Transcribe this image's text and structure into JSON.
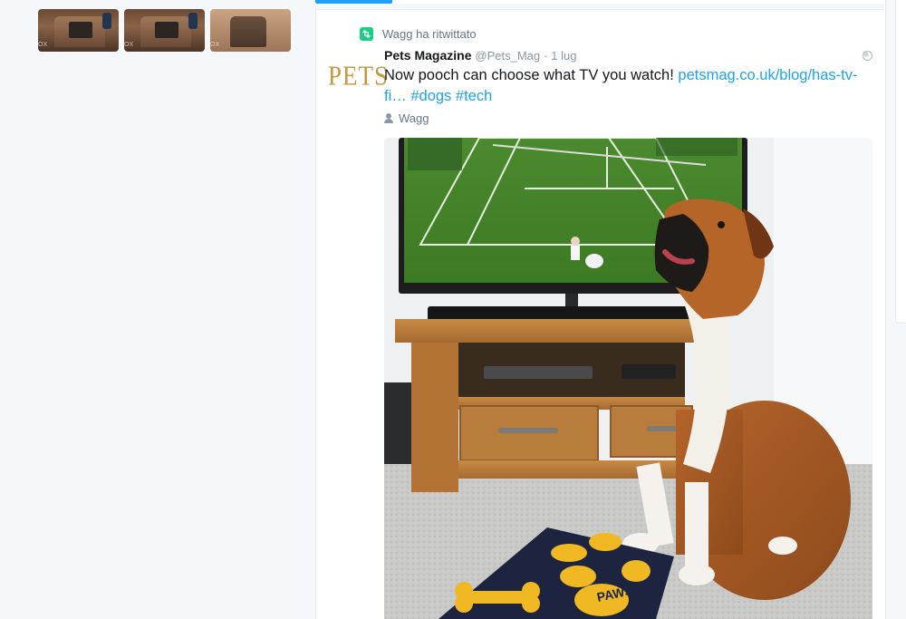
{
  "left_media": {
    "thumbnails": [
      {
        "caption": "OX"
      },
      {
        "caption": "OX"
      },
      {
        "caption": "OX"
      }
    ]
  },
  "timeline": {
    "active_tab_color": "#1da1f2"
  },
  "tweet": {
    "retweet_context": "Wagg ha ritwittato",
    "avatar_text": "PETS",
    "author_name": "Pets Magazine",
    "author_handle": "@Pets_Mag",
    "separator": "·",
    "timestamp": "1 lug",
    "text_before_link": "Now pooch can choose what TV you watch! ",
    "link_text": "petsmag.co.uk/blog/has-tv-fi…",
    "hashtag_1": "#dogs",
    "hashtag_2": "#tech",
    "mentioned_user": "Wagg",
    "media_remote_text": "PAWS"
  },
  "colors": {
    "retweet_green": "#19cf86",
    "link_blue": "#1da1f2",
    "brand_gold": "#c8963e",
    "muted_gray": "#657786"
  },
  "icons": [
    "retweet-icon",
    "globe-icon",
    "person-icon"
  ]
}
